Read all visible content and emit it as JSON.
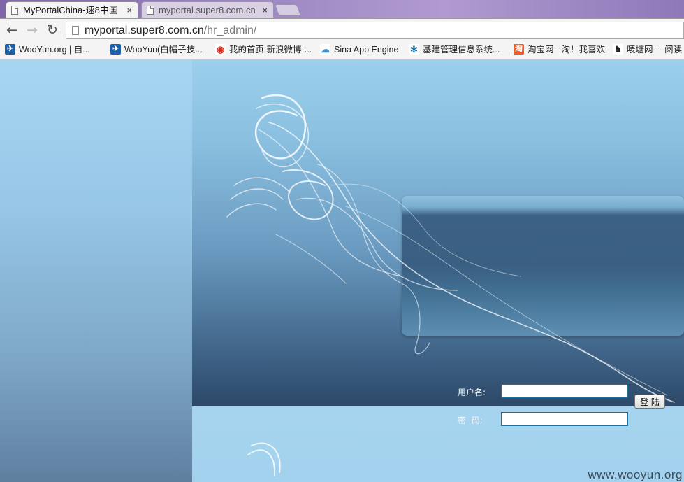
{
  "browser": {
    "tabs": [
      {
        "title": "MyPortalChina-速8中国",
        "close": "×",
        "active": true
      },
      {
        "title": "myportal.super8.com.cn",
        "close": "×",
        "active": false
      }
    ],
    "address": {
      "host": "myportal.super8.com.cn",
      "path": "/hr_admin/"
    },
    "nav": {
      "back": "←",
      "forward": "→",
      "reload": "↻"
    },
    "bookmarks": [
      {
        "label": "WooYun.org | 自...",
        "icon": "wooyun-icon",
        "color": "#1a5fa8"
      },
      {
        "label": "WooYun(白帽子技...",
        "icon": "wooyun-icon",
        "color": "#1a5fa8"
      },
      {
        "label": "我的首页 新浪微博-...",
        "icon": "weibo-icon",
        "color": "#d52b1e"
      },
      {
        "label": "Sina App Engine",
        "icon": "cloud-icon",
        "color": "#4a90c8"
      },
      {
        "label": "基建管理信息系统...",
        "icon": "network-icon",
        "color": "#1f6f9e"
      },
      {
        "label": "淘宝网 - 淘！我喜欢",
        "icon": "taobao-icon",
        "color": "#f05a24"
      },
      {
        "label": "唛塘网----阅读",
        "icon": "penguin-icon",
        "color": "#222222"
      }
    ]
  },
  "login": {
    "username_label": "用户名:",
    "password_label": "密  码:",
    "username_value": "",
    "password_value": "",
    "submit_label": "登 陆"
  },
  "watermark": "www.wooyun.org"
}
